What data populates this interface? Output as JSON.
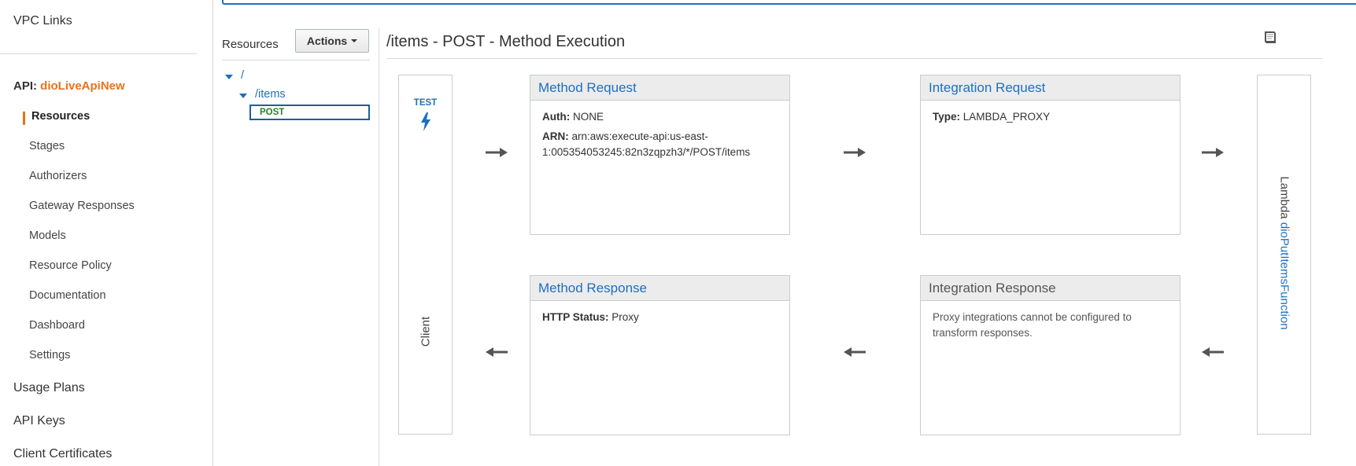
{
  "nav": {
    "vpc_links": "VPC Links",
    "api_prefix": "API:",
    "api_name": "dioLiveApiNew",
    "items": [
      "Resources",
      "Stages",
      "Authorizers",
      "Gateway Responses",
      "Models",
      "Resource Policy",
      "Documentation",
      "Dashboard",
      "Settings"
    ],
    "usage_plans": "Usage Plans",
    "api_keys": "API Keys",
    "client_certificates": "Client Certificates"
  },
  "resources": {
    "title": "Resources",
    "actions_label": "Actions",
    "tree": {
      "root": "/",
      "items": "/items",
      "method": "POST"
    }
  },
  "execution": {
    "title": "/items - POST - Method Execution",
    "test_label": "TEST",
    "client_label": "Client",
    "lambda_prefix": "Lambda",
    "lambda_function": "dioPutItemsFunction",
    "method_request": {
      "title": "Method Request",
      "auth_key": "Auth:",
      "auth_value": "NONE",
      "arn_key": "ARN:",
      "arn_value": "arn:aws:execute-api:us-east-1:005354053245:82n3zqpzh3/*/POST/items"
    },
    "integration_request": {
      "title": "Integration Request",
      "type_key": "Type:",
      "type_value": "LAMBDA_PROXY"
    },
    "method_response": {
      "title": "Method Response",
      "status_key": "HTTP Status:",
      "status_value": "Proxy"
    },
    "integration_response": {
      "title": "Integration Response",
      "note": "Proxy integrations cannot be configured to transform responses."
    }
  },
  "colors": {
    "accent": "#e8721c",
    "link": "#1f6fbf",
    "arrow": "#555555"
  },
  "icons": [
    "book-icon",
    "lightning-icon",
    "caret-down-icon",
    "arrow-right-icon",
    "arrow-left-icon"
  ]
}
